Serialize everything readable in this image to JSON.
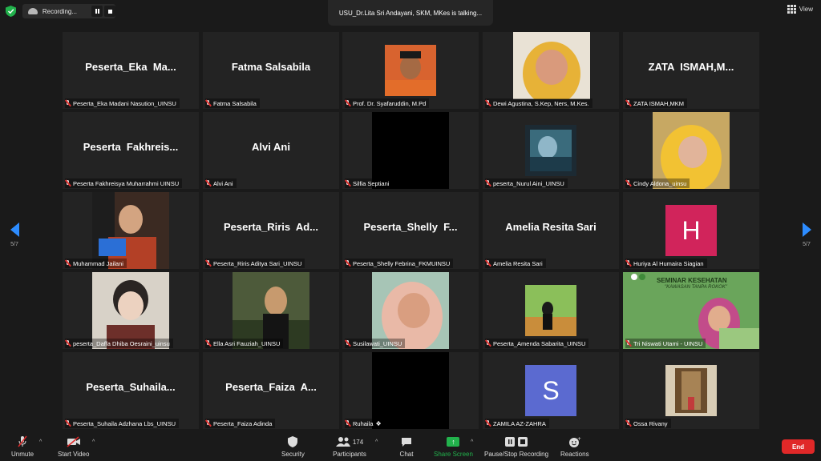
{
  "top_bar": {
    "recording_label": "Recording...",
    "talking_text": "USU_Dr.Lita Sri Andayani, SKM, MKes is talking...",
    "view_label": "View"
  },
  "pagination": {
    "left": "5/7",
    "right": "5/7"
  },
  "colors": {
    "accent": "#2d8cff",
    "share_green": "#22b24c",
    "end_red": "#e02828"
  },
  "tiles": [
    {
      "name": "Peserta_Eka  Ma...",
      "label": "Peserta_Eka Madani Nasution_UINSU"
    },
    {
      "name": "Fatma Salsabila",
      "label": "Fatma Salsabila"
    },
    {
      "name": "",
      "label": "Prof. Dr. Syafaruddin, M.Pd"
    },
    {
      "name": "",
      "label": "Dewi Agustina, S.Kep, Ners, M.Kes."
    },
    {
      "name": "ZATA  ISMAH,M...",
      "label": "ZATA ISMAH,MKM"
    },
    {
      "name": "Peserta  Fakhreis...",
      "label": "Peserta Fakhreisya Muharrahmi UINSU"
    },
    {
      "name": "Alvi Ani",
      "label": "Alvi Ani"
    },
    {
      "name": "",
      "label": "Silfia Septiani"
    },
    {
      "name": "",
      "label": "peserta_Nurul Aini_UINSU"
    },
    {
      "name": "",
      "label": "Cindy Aldona_uinsu"
    },
    {
      "name": "",
      "label": "Muhammad Jailani"
    },
    {
      "name": "Peserta_Riris  Ad...",
      "label": "Peserta_Riris Aditya Sari_UINSU"
    },
    {
      "name": "Peserta_Shelly  F...",
      "label": "Peserta_Shelly Febrina_FKMUINSU"
    },
    {
      "name": "Amelia Resita Sari",
      "label": "Amelia Resita Sari"
    },
    {
      "name": "",
      "label": "Huriya Al Humaira Siagian",
      "letter": "H"
    },
    {
      "name": "",
      "label": "peserta_Daffa Dhiba Oesraini_uinsu"
    },
    {
      "name": "",
      "label": "Ella Asri Fauziah_UINSU"
    },
    {
      "name": "",
      "label": "Susilawati_UINSU"
    },
    {
      "name": "",
      "label": "Peserta_Amenda Sabarita_UINSU"
    },
    {
      "name": "",
      "label": "Tri Niswati Utami - UINSU",
      "banner": "SEMINAR KESEHATAN",
      "banner_sub": "\"KAWASAN TANPA ROKOK\""
    },
    {
      "name": "Peserta_Suhaila...",
      "label": "Peserta_Suhaila Adzhana Lbs_UINSU"
    },
    {
      "name": "Peserta_Faiza  A...",
      "label": "Peserta_Faiza Adinda"
    },
    {
      "name": "",
      "label": "Ruhaila"
    },
    {
      "name": "",
      "label": "ZAMILA AZ-ZAHRA",
      "letter": "S"
    },
    {
      "name": "",
      "label": "Ossa Rivany"
    }
  ],
  "toolbar": {
    "unmute": "Unmute",
    "start_video": "Start Video",
    "security": "Security",
    "participants": "Participants",
    "participants_count": "174",
    "chat": "Chat",
    "share_screen": "Share Screen",
    "pause_recording": "Pause/Stop Recording",
    "reactions": "Reactions",
    "end": "End"
  }
}
